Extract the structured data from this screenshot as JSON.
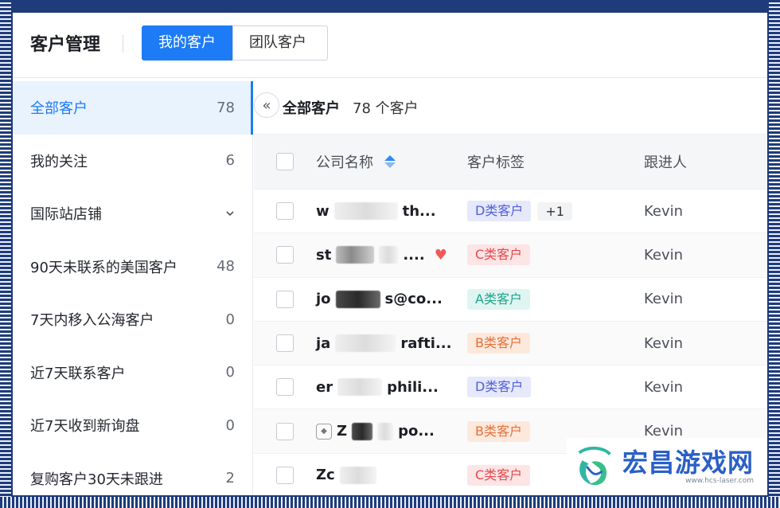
{
  "header": {
    "title": "客户管理",
    "tabs": [
      {
        "label": "我的客户",
        "active": true
      },
      {
        "label": "团队客户",
        "active": false
      }
    ]
  },
  "sidebar": {
    "items": [
      {
        "label": "全部客户",
        "count": "78",
        "active": true
      },
      {
        "label": "我的关注",
        "count": "6"
      },
      {
        "label": "国际站店铺",
        "count": "",
        "expandable": true
      },
      {
        "label": "90天未联系的美国客户",
        "count": "48"
      },
      {
        "label": "7天内移入公海客户",
        "count": "0"
      },
      {
        "label": "近7天联系客户",
        "count": "0"
      },
      {
        "label": "近7天收到新询盘",
        "count": "0"
      },
      {
        "label": "复购客户30天未跟进",
        "count": "2"
      }
    ]
  },
  "main": {
    "title": "全部客户",
    "count_text": "78 个客户",
    "collapse_icon": "double-chevron-left-icon",
    "columns": {
      "company": "公司名称",
      "tag": "客户标签",
      "owner": "跟进人"
    },
    "rows": [
      {
        "company_start": "w",
        "company_end": "th...",
        "tag": "D类客户",
        "tag_class": "D",
        "extra": "+1",
        "owner": "Kevin"
      },
      {
        "company_start": "st",
        "company_end": "....",
        "tag": "C类客户",
        "tag_class": "C",
        "favorite": true,
        "owner": "Kevin"
      },
      {
        "company_start": "jo",
        "company_end": "s@co...",
        "tag": "A类客户",
        "tag_class": "A",
        "owner": "Kevin"
      },
      {
        "company_start": "ja",
        "company_end": "rafti...",
        "tag": "B类客户",
        "tag_class": "B",
        "owner": "Kevin"
      },
      {
        "company_start": "er",
        "company_end": "phili...",
        "tag": "D类客户",
        "tag_class": "D",
        "owner": "Kevin"
      },
      {
        "company_start": "Z",
        "company_end": "po...",
        "tag": "B类客户",
        "tag_class": "B",
        "owner": "Kevin"
      },
      {
        "company_start": "Zc",
        "company_end": "",
        "tag": "C类客户",
        "tag_class": "C",
        "owner": ""
      }
    ]
  },
  "watermark": {
    "title": "宏昌游戏网",
    "url": "www.hcs-laser.com"
  },
  "colors": {
    "accent": "#1d7bf5",
    "frame": "#1f3c7a"
  }
}
